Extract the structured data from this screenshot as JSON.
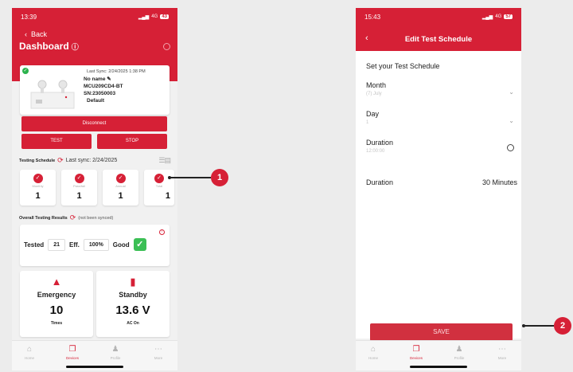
{
  "left_phone": {
    "status_time": "13:39",
    "status_net": "4G",
    "status_batt": "43",
    "back_label": "Back",
    "title": "Dashboard",
    "device": {
      "last_sync": "Last Sync: 2/24/2025 1:38 PM",
      "name": "No name",
      "model": "MCU209CD4-BT",
      "serial": "SN:23050003",
      "group": "Default"
    },
    "disconnect_label": "Disconnect",
    "test_label": "TEST",
    "stop_label": "STOP",
    "schedule": {
      "label": "Testing Schedule",
      "last_sync": "Last sync: 2/24/2025"
    },
    "counters": [
      {
        "sub": "Monthly",
        "value": "1"
      },
      {
        "sub": "Pass/fail",
        "value": "1"
      },
      {
        "sub": "Annual",
        "value": "1"
      },
      {
        "sub": "Total",
        "value": "1"
      }
    ],
    "overall": {
      "label": "Overall Testing Results",
      "note": "(not been synced)"
    },
    "results": {
      "tested_label": "Tested",
      "tested_value": "21",
      "eff_label": "Eff.",
      "eff_value": "100%",
      "status_label": "Good"
    },
    "emergency": {
      "title": "Emergency",
      "value": "10",
      "caption": "Times"
    },
    "standby": {
      "title": "Standby",
      "value": "13.6 V",
      "caption": "AC On"
    },
    "tabs": [
      {
        "label": "Home",
        "icon": "home-icon",
        "glyph": "⌂"
      },
      {
        "label": "Devices",
        "icon": "devices-icon",
        "glyph": "❐"
      },
      {
        "label": "Profile",
        "icon": "profile-icon",
        "glyph": "♟"
      },
      {
        "label": "More",
        "icon": "more-icon",
        "glyph": "⋯"
      }
    ]
  },
  "right_phone": {
    "status_time": "15:43",
    "status_net": "4G",
    "status_batt": "57",
    "nav_title": "Edit Test Schedule",
    "set_title": "Set your Test Schedule",
    "month_label": "Month",
    "month_value": "(7) July",
    "day_label": "Day",
    "day_value": "1",
    "duration_label": "Duration",
    "duration_value": "12:00:00",
    "duration2_label": "Duration",
    "duration2_value": "30 Minutes",
    "save_label": "SAVE",
    "tabs": [
      {
        "label": "Home",
        "glyph": "⌂"
      },
      {
        "label": "Devices",
        "glyph": "❐"
      },
      {
        "label": "Profile",
        "glyph": "♟"
      },
      {
        "label": "More",
        "glyph": "⋯"
      }
    ]
  },
  "callouts": {
    "one": "1",
    "two": "2"
  },
  "colors": {
    "brand_red": "#d62036",
    "good_green": "#3bbf55"
  }
}
